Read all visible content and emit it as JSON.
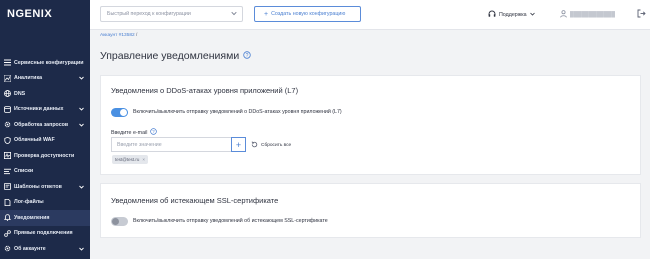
{
  "app": {
    "logo": "NGENIX"
  },
  "sidebar": {
    "items": [
      {
        "label": "Сервисные конфигурации",
        "icon": "list-icon",
        "chevron": false
      },
      {
        "label": "Аналитика",
        "icon": "chart-icon",
        "chevron": true
      },
      {
        "label": "DNS",
        "icon": "globe-icon",
        "chevron": false
      },
      {
        "label": "Источники данных",
        "icon": "database-icon",
        "chevron": true
      },
      {
        "label": "Обработка запросов",
        "icon": "gear-icon",
        "chevron": true
      },
      {
        "label": "Облачный WAF",
        "icon": "shield-icon",
        "chevron": false
      },
      {
        "label": "Проверка доступности",
        "icon": "pulse-icon",
        "chevron": false
      },
      {
        "label": "Списки",
        "icon": "lines-icon",
        "chevron": false
      },
      {
        "label": "Шаблоны ответов",
        "icon": "template-icon",
        "chevron": true
      },
      {
        "label": "Лог-файлы",
        "icon": "file-icon",
        "chevron": false
      },
      {
        "label": "Уведомления",
        "icon": "bell-icon",
        "chevron": false,
        "active": true
      },
      {
        "label": "Прямые подключения",
        "icon": "link-icon",
        "chevron": false
      },
      {
        "label": "Об аккаунте",
        "icon": "gear-icon",
        "chevron": true
      }
    ]
  },
  "topbar": {
    "quick_placeholder": "Быстрый переход к конфигурации",
    "create_label": "Создать новую конфигурацию",
    "support_label": "Поддержка",
    "user_label": "████████████"
  },
  "breadcrumb": {
    "account": "Аккаунт #13582",
    "separator": "/"
  },
  "page": {
    "title": "Управление уведомлениями"
  },
  "ddos_card": {
    "title": "Уведомления о DDoS-атаках уровня приложений (L7)",
    "toggle_label": "Включить/выключить отправку уведомлений о DDoS-атаках уровня приложений (L7)",
    "toggle_on": true,
    "email_label": "Введите e-mail",
    "email_placeholder": "Введите значение",
    "email_value": "",
    "reset_label": "Сбросить все",
    "chips": [
      "test@test.ru"
    ]
  },
  "ssl_card": {
    "title": "Уведомления об истекающем SSL-сертификате",
    "toggle_label": "Включить/выключить отправку уведомлений об истекающем SSL-сертификате",
    "toggle_on": false
  },
  "colors": {
    "sidebar_bg": "#1d2a49",
    "accent": "#4a90e2",
    "page_bg": "#f2f3f5"
  }
}
